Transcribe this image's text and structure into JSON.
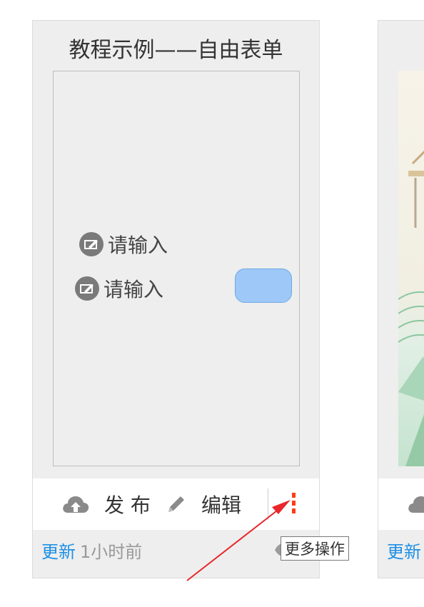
{
  "card1": {
    "title": "教程示例——自由表单",
    "preview": {
      "field1_label": "请输入",
      "field2_label": "请输入",
      "field_icon": "edit-box-icon"
    },
    "actions": {
      "publish_label": "发 布",
      "publish_icon": "cloud-upload-icon",
      "edit_label": "编辑",
      "edit_icon": "pencil-icon",
      "more_icon": "vertical-dots-icon"
    },
    "footer": {
      "update_label": "更新",
      "time_label": "1小时前"
    },
    "tooltip": "更多操作"
  },
  "card2": {
    "footer": {
      "update_label": "更新"
    }
  },
  "colors": {
    "accent_link": "#1e90e6",
    "more_dots": "#ff3b1a",
    "toggle_fill": "#9ec8f7",
    "arrow": "#e8262b"
  }
}
